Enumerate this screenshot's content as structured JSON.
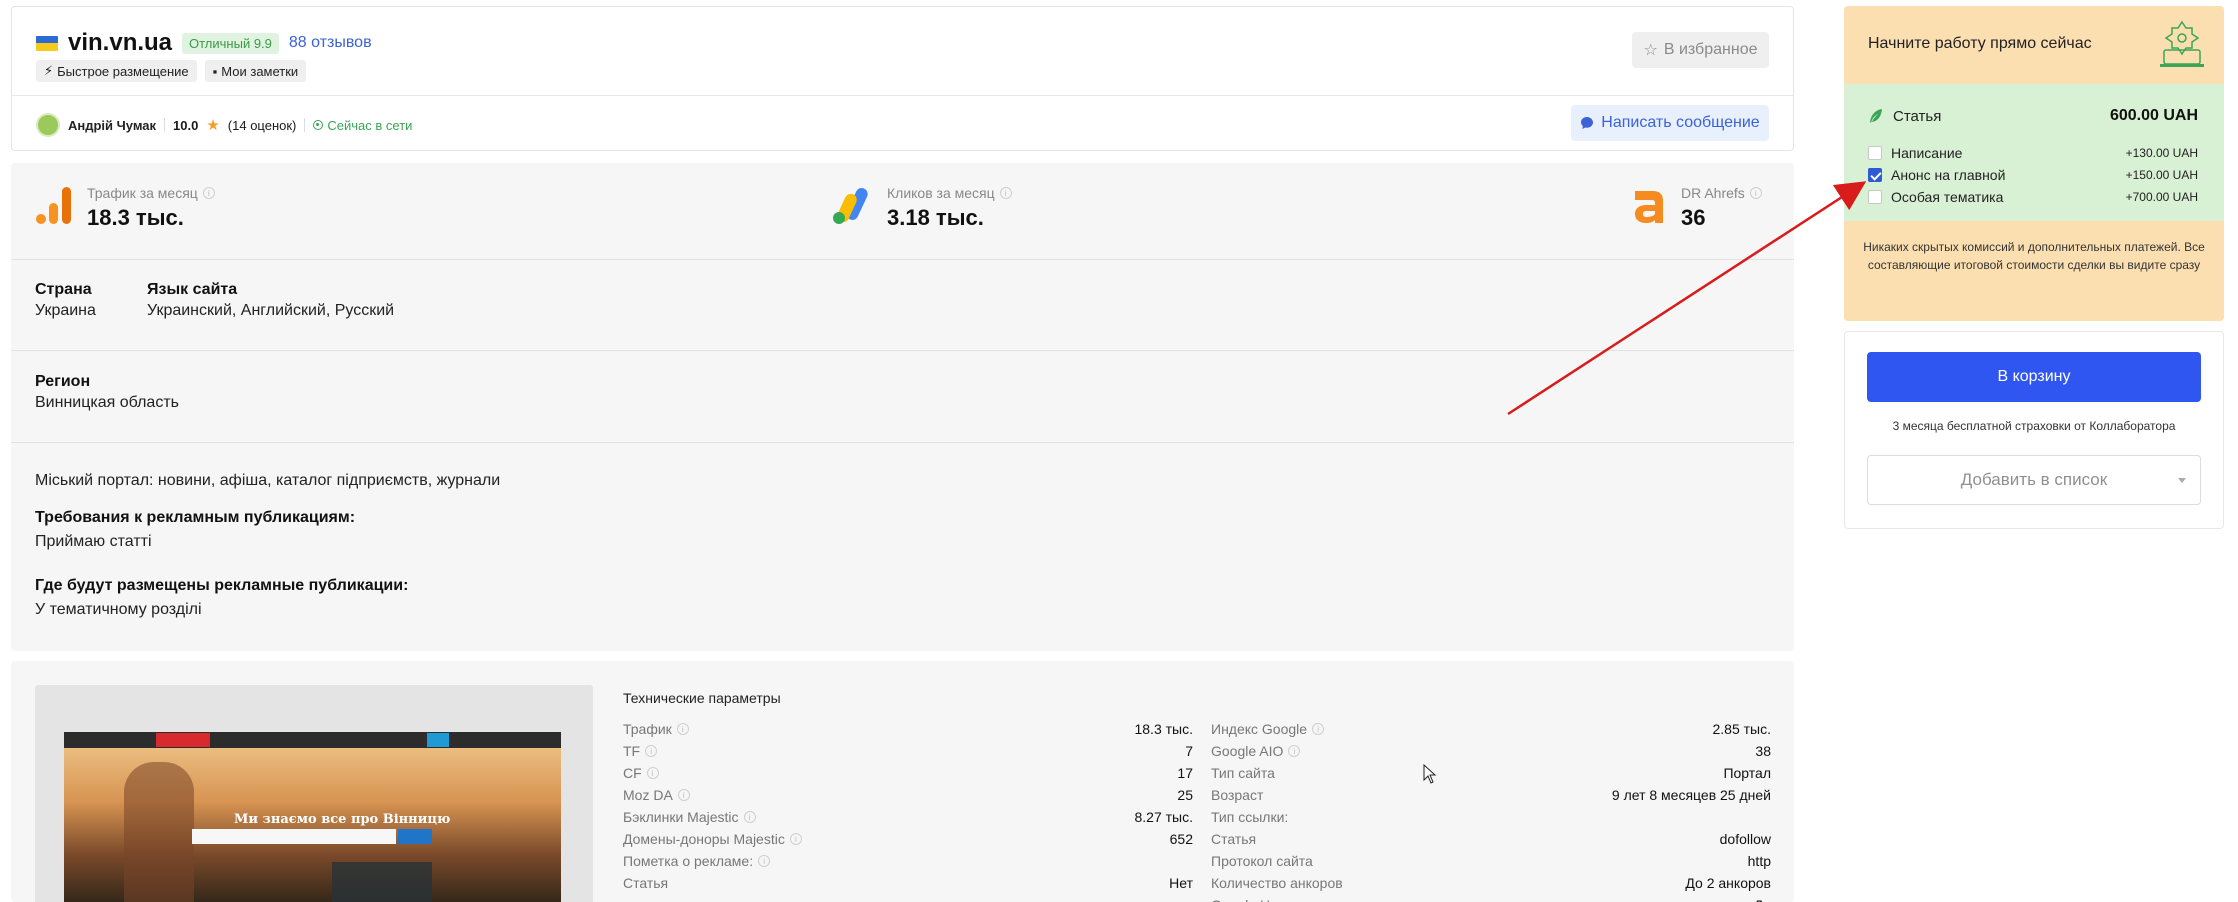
{
  "site": {
    "name": "vin.vn.ua",
    "rating_badge": "Отличный 9.9",
    "reviews": "88 отзывов",
    "tags": [
      "Быстрое размещение",
      "Мои заметки"
    ],
    "favorite_label": "В избранное"
  },
  "author": {
    "name": "Андрій Чумак",
    "score": "10.0",
    "ratings_count": "(14 оценок)",
    "status": "Сейчас в сети",
    "message_label": "Написать сообщение"
  },
  "metrics": [
    {
      "label": "Трафик за месяц",
      "value": "18.3 тыс.",
      "icon": "traffic-bars-icon"
    },
    {
      "label": "Кликов за месяц",
      "value": "3.18 тыс.",
      "icon": "google-ads-icon"
    },
    {
      "label": "DR Ahrefs",
      "value": "36",
      "icon": "ahrefs-icon"
    }
  ],
  "details": {
    "country_label": "Страна",
    "country": "Украина",
    "language_label": "Язык сайта",
    "languages": "Украинский, Английский, Русский",
    "region_label": "Регион",
    "region": "Винницкая область",
    "description": "Міський портал: новини, афіша, каталог підприємств, журнали",
    "requirements_label": "Требования к рекламным публикациям:",
    "requirements": "Приймаю статті",
    "placement_label": "Где будут размещены рекламные публикации:",
    "placement": "У тематичному розділі"
  },
  "preview": {
    "headline": "Ми знаємо все про Вінницю"
  },
  "tech": {
    "title": "Технические параметры",
    "left": [
      {
        "k": "Трафик",
        "v": "18.3 тыс.",
        "info": true
      },
      {
        "k": "TF",
        "v": "7",
        "info": true
      },
      {
        "k": "CF",
        "v": "17",
        "info": true
      },
      {
        "k": "Moz DA",
        "v": "25",
        "info": true
      },
      {
        "k": "Бэклинки Majestic",
        "v": "8.27 тыс.",
        "info": true
      },
      {
        "k": "Домены-доноры Majestic",
        "v": "652",
        "info": true
      },
      {
        "k": "Пометка о рекламе:",
        "v": "",
        "info": true
      },
      {
        "k": "Статья",
        "v": "Нет",
        "info": false
      }
    ],
    "right": [
      {
        "k": "Индекс Google",
        "v": "2.85 тыс.",
        "info": true
      },
      {
        "k": "Google AIO",
        "v": "38",
        "info": true
      },
      {
        "k": "Тип сайта",
        "v": "Портал",
        "info": false
      },
      {
        "k": "Возраст",
        "v": "9 лет 8 месяцев 25 дней",
        "info": false
      },
      {
        "k": "Тип ссылки:",
        "v": "",
        "info": false
      },
      {
        "k": "Статья",
        "v": "dofollow",
        "info": false
      },
      {
        "k": "Протокол сайта",
        "v": "http",
        "info": false
      },
      {
        "k": "Количество анкоров",
        "v": "До 2 анкоров",
        "info": false
      },
      {
        "k": "Google Новости",
        "v": "Да",
        "info": false
      }
    ]
  },
  "sidebar": {
    "promo": "Начните работу прямо сейчас",
    "product_label": "Статья",
    "product_price": "600.00 UAH",
    "options": [
      {
        "label": "Написание",
        "price": "+130.00 UAH",
        "checked": false
      },
      {
        "label": "Анонс на главной",
        "price": "+150.00 UAH",
        "checked": true
      },
      {
        "label": "Особая тематика",
        "price": "+700.00 UAH",
        "checked": false
      }
    ],
    "note": "Никаких скрытых комиссий и дополнительных платежей. Все составляющие итоговой стоимости сделки вы видите сразу",
    "cart_label": "В корзину",
    "insurance": "3 месяца бесплатной страховки от Коллаборатора",
    "add_list_label": "Добавить в список"
  },
  "colors": {
    "accent_blue": "#2f56f0",
    "promo_bg": "#fcdfb0",
    "price_bg": "#d8f0d4",
    "annotation_arrow": "#d81b1b"
  }
}
